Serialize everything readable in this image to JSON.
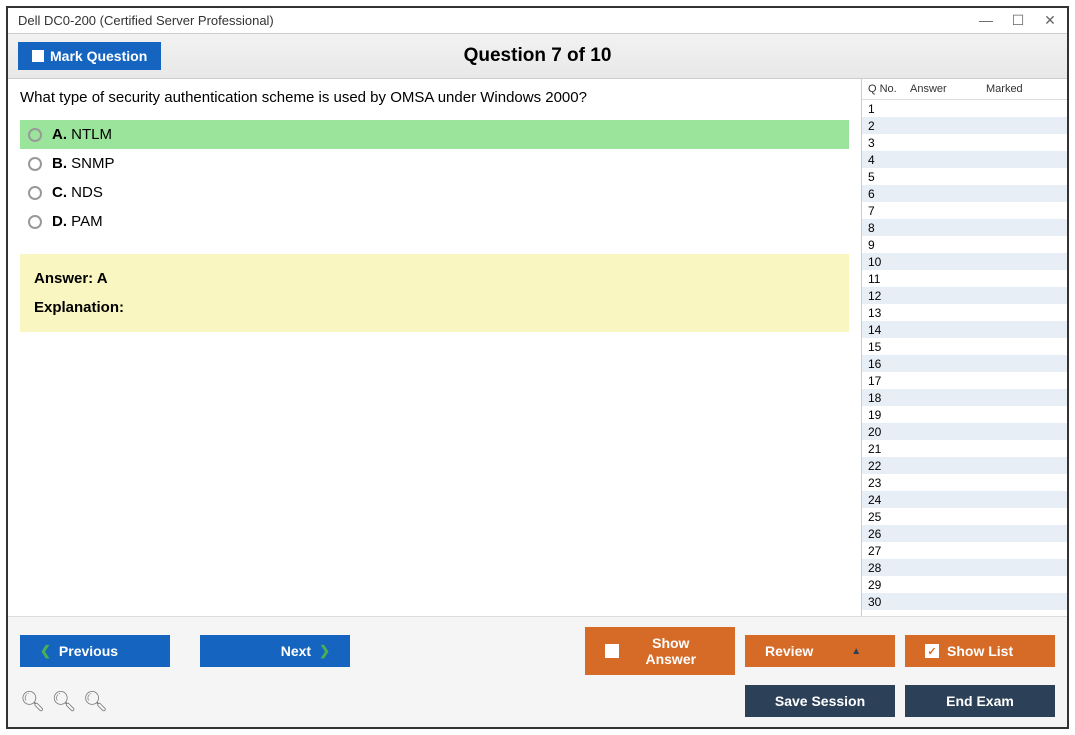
{
  "window": {
    "title": "Dell DC0-200 (Certified Server Professional)"
  },
  "header": {
    "mark_label": "Mark Question",
    "question_title": "Question 7 of 10"
  },
  "question": {
    "text": "What type of security authentication scheme is used by OMSA under Windows 2000?",
    "options": [
      {
        "letter": "A.",
        "text": "NTLM",
        "correct": true
      },
      {
        "letter": "B.",
        "text": "SNMP",
        "correct": false
      },
      {
        "letter": "C.",
        "text": "NDS",
        "correct": false
      },
      {
        "letter": "D.",
        "text": "PAM",
        "correct": false
      }
    ],
    "answer_label": "Answer: A",
    "explanation_label": "Explanation:"
  },
  "sidebar": {
    "col_qno": "Q No.",
    "col_answer": "Answer",
    "col_marked": "Marked",
    "rows": 30
  },
  "footer": {
    "previous": "Previous",
    "next": "Next",
    "show_answer": "Show Answer",
    "review": "Review",
    "show_list": "Show List",
    "save_session": "Save Session",
    "end_exam": "End Exam"
  }
}
